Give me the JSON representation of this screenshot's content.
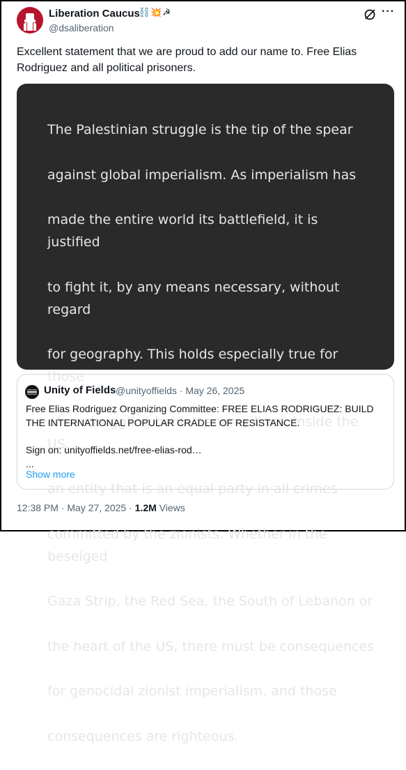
{
  "author": {
    "name": "Liberation Caucus",
    "name_emojis": "⛓️💥☭",
    "handle": "@dsaliberation"
  },
  "icons": {
    "avatar": "fist-logo-icon",
    "grok": "grok-slash-icon",
    "more": "more-options-icon",
    "quoted_avatar": "unity-of-fields-logo-icon"
  },
  "post": {
    "text": "Excellent statement that we are proud to add our name to. Free Elias Rodriguez and all political prisoners."
  },
  "image_text": {
    "lines": [
      "The Palestinian struggle is the tip of the spear",
      "against global imperialism. As imperialism has",
      "made the entire world its battlefield, it is justified",
      "to fight it, by any means necessary, without regard",
      "for geography. This holds especially true for those",
      "of us struggling behind enemy lines, inside the US,",
      "an entity that is an equal party in all crimes",
      "committed by the zionists. Whether in the beseiged",
      "Gaza Strip, the Red Sea, the South of Lebanon or",
      "the heart of the US, there must be consequences",
      "for genocidal zionist imperialism, and those",
      "consequences are righteous."
    ]
  },
  "quoted": {
    "name": "Unity of Fields",
    "handle_date": "@unityoffields · May 26, 2025",
    "line1": "Free Elias Rodriguez Organizing Committee: FREE ELIAS RODRIGUEZ: BUILD",
    "line2": "THE INTERNATIONAL POPULAR CRADLE OF RESISTANCE.",
    "line3": "Sign on: unityoffields.net/free-elias-rod…",
    "line4": "...",
    "show_more": "Show more"
  },
  "meta": {
    "time_date": "12:38 PM · May 27, 2025 · ",
    "views_count": "1.2M",
    "views_label": " Views"
  },
  "colors": {
    "avatar_bg": "#b5162c",
    "image_bg": "#2a2a2a",
    "link": "#1d9bf0",
    "muted": "#536471"
  }
}
